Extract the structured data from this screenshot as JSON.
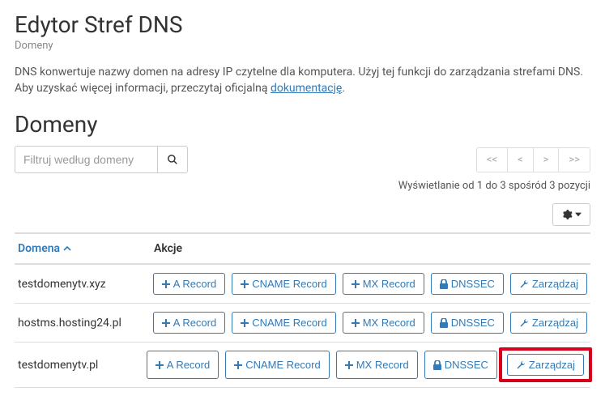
{
  "page": {
    "title": "Edytor Stref DNS",
    "breadcrumb": "Domeny",
    "description_pre": "DNS konwertuje nazwy domen na adresy IP czytelne dla komputera. Użyj tej funkcji do zarządzania strefami DNS. Aby uzyskać więcej informacji, przeczytaj oficjalną ",
    "description_link": "dokumentację",
    "description_post": "."
  },
  "section": {
    "title": "Domeny",
    "filter_placeholder": "Filtruj według domeny",
    "status": "Wyświetlanie od 1 do 3 spośród 3 pozycji"
  },
  "pager": {
    "first": "<<",
    "prev": "<",
    "next": ">",
    "last": ">>"
  },
  "headers": {
    "domain": "Domena",
    "actions": "Akcje"
  },
  "action_labels": {
    "a": "A Record",
    "cname": "CNAME Record",
    "mx": "MX Record",
    "dnssec": "DNSSEC",
    "manage": "Zarządzaj"
  },
  "rows": [
    {
      "domain": "testdomenytv.xyz",
      "highlighted": false
    },
    {
      "domain": "hostms.hosting24.pl",
      "highlighted": false
    },
    {
      "domain": "testdomenytv.pl",
      "highlighted": true
    }
  ],
  "colors": {
    "primary": "#337ab7",
    "highlight": "#d9001b"
  }
}
